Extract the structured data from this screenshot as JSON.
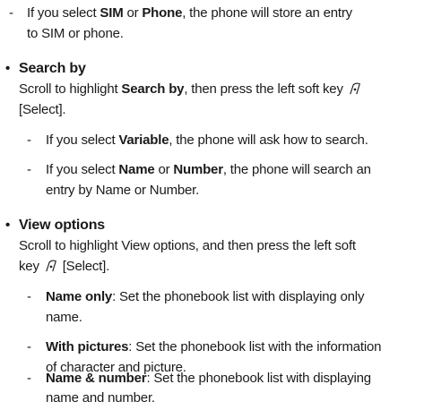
{
  "block1": {
    "dash": "-",
    "line1": {
      "a": "If you select ",
      "b1": "SIM",
      "c": " or ",
      "b2": "Phone",
      "d": ", the phone will store an entry"
    },
    "line2": "to SIM or phone."
  },
  "search_by": {
    "bullet": "•",
    "title": "Search by",
    "line1": {
      "a": "Scroll to highlight ",
      "b": "Search by",
      "c": ", then press the left soft key"
    },
    "line2": "[Select].",
    "item1": {
      "dash": "-",
      "a": "If you select ",
      "b": "Variable",
      "c": ", the phone will ask how to search."
    },
    "item2": {
      "dash": "-",
      "line1": {
        "a": "If you select ",
        "b1": "Name",
        "c": " or ",
        "b2": "Number",
        "d": ", the phone will search an"
      },
      "line2": "entry by Name or Number."
    }
  },
  "view_options": {
    "bullet": "•",
    "title": "View options",
    "line1": "Scroll to highlight View options, and then press the left soft",
    "line2": {
      "a": "key",
      "b": "[Select]."
    },
    "item1": {
      "dash": "-",
      "b": "Name only",
      "c": ": Set the phonebook list with displaying only",
      "line2": "name."
    },
    "item2": {
      "dash": "-",
      "b": "With pictures",
      "c": ": Set the phonebook list with the information",
      "line2": "of character and picture."
    },
    "item3": {
      "dash": "-",
      "b": "Name & number",
      "c": ": Set the phonebook list with displaying",
      "line2": "name and number."
    }
  },
  "icons": {
    "softkey": "left-soft-key-icon"
  }
}
